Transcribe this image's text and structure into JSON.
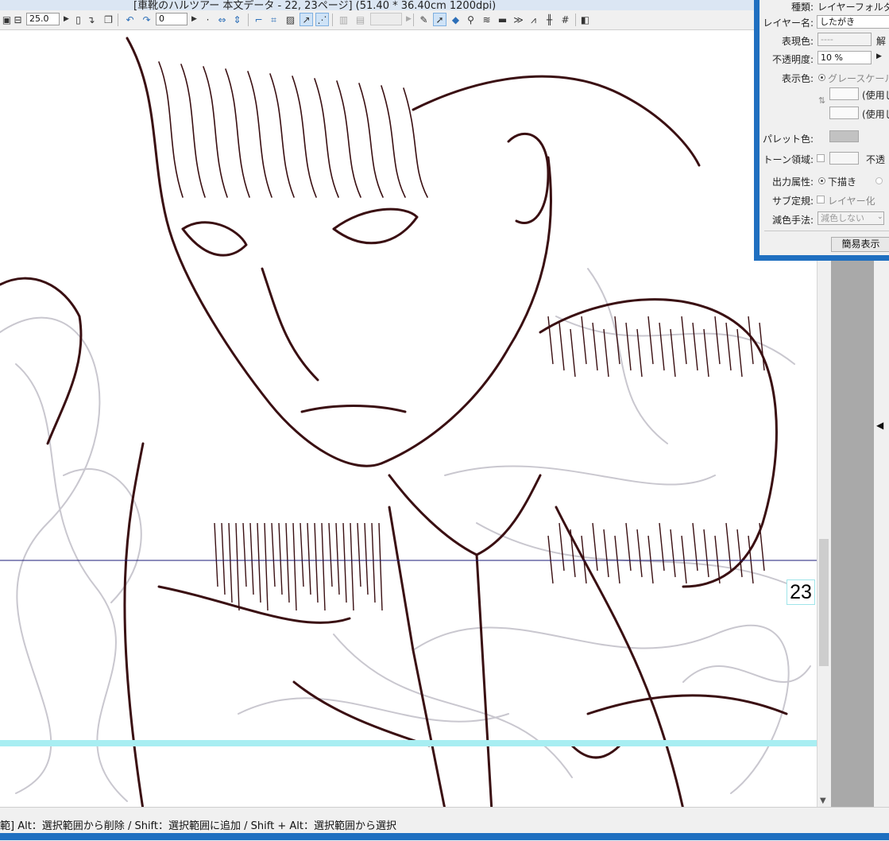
{
  "window": {
    "title": "[車靴のハルツアー 本文データ - 22, 23ページ] (51.40 * 36.40cm 1200dpi)"
  },
  "toolbar": {
    "zoom_value": "25.0",
    "rotation_value": "0"
  },
  "canvas": {
    "page_number": "23",
    "line_color": "#3a0f12",
    "sketch_color": "#c9c7cf",
    "guide_blue": "#1b1b7a",
    "guide_cyan": "#a8eef2"
  },
  "layer_panel": {
    "type_label": "種類:",
    "type_value": "レイヤーフォルダ",
    "name_label": "レイヤー名:",
    "name_value": "したがき",
    "expression_label": "表現色:",
    "expression_value": "----",
    "expression_trailing": "解",
    "opacity_label": "不透明度:",
    "opacity_value": "10 %",
    "display_color_label": "表示色:",
    "display_color_value": "グレースケール",
    "unused_1": "(使用し",
    "unused_2": "(使用し",
    "palette_label": "パレット色:",
    "tone_label": "トーン領域:",
    "tone_trailing": "不透",
    "output_label": "出力属性:",
    "output_value": "下描き",
    "sub_ruler_label": "サブ定規:",
    "sub_ruler_value": "レイヤー化",
    "reduce_label": "減色手法:",
    "reduce_value": "減色しない",
    "simple_button": "簡易表示"
  },
  "status": {
    "hint": "範] Alt：選択範囲から削除 / Shift：選択範囲に追加 / Shift + Alt：選択範囲から選択"
  },
  "colors": {
    "panel_border": "#1f6fc0",
    "chrome": "#f0f0f0",
    "scroll_gray": "#a9a9a9"
  }
}
